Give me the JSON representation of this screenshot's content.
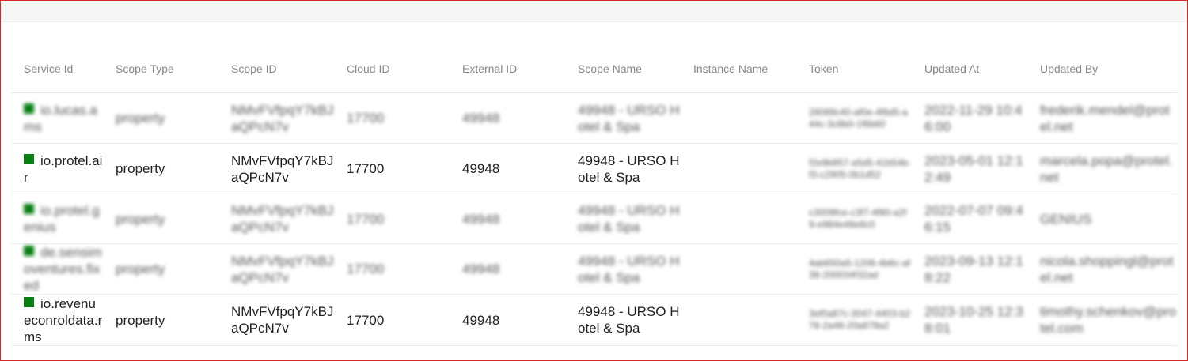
{
  "colors": {
    "frame": "#d42a2a",
    "status_square": "#0a7f14",
    "header_text": "#888888"
  },
  "table": {
    "headers": [
      "Service Id",
      "Scope Type",
      "Scope ID",
      "Cloud ID",
      "External ID",
      "Scope Name",
      "Instance Name",
      "Token",
      "Updated At",
      "Updated By"
    ],
    "rows": [
      {
        "service_id": "io.lucas.ams",
        "scope_type": "property",
        "scope_id": "NMvFVfpqY7kBJaQPcN7v",
        "cloud_id": "17700",
        "external_id": "49948",
        "scope_name": "49948 - URSO Hotel & Spa",
        "instance_name": "",
        "token": "28089c40-af0e-4f6d5-a44c-3c8b0-1f6b60",
        "updated_at": "2022-11-29 10:46:00",
        "updated_by": "frederik.mendel@protel.net",
        "blurred": true
      },
      {
        "service_id": "io.protel.air",
        "scope_type": "property",
        "scope_id": "NMvFVfpqY7kBJaQPcN7v",
        "cloud_id": "17700",
        "external_id": "49948",
        "scope_name": "49948 - URSO Hotel & Spa",
        "instance_name": "",
        "token": "f2e9b857-a5d5-41b54b-f3-c2905-0b1d52",
        "updated_at": "2023-05-01 12:12:49",
        "updated_by": "marcela.popa@protel.net",
        "blurred": false
      },
      {
        "service_id": "io.protel.genius",
        "scope_type": "property",
        "scope_id": "NMvFVfpqY7kBJaQPcN7v",
        "cloud_id": "17700",
        "external_id": "49948",
        "scope_name": "49948 - URSO Hotel & Spa",
        "instance_name": "",
        "token": "c3009fce-c3f7-4f80-a2f9-e984e48e8c0",
        "updated_at": "2022-07-07 09:46:15",
        "updated_by": "GENIUS",
        "blurred": true
      },
      {
        "service_id": "de.sensimoventures.fixed",
        "scope_type": "property",
        "scope_id": "NMvFVfpqY7kBJaQPcN7v",
        "cloud_id": "17700",
        "external_id": "49948",
        "scope_name": "49948 - URSO Hotel & Spa",
        "instance_name": "",
        "token": "4ab650a5-1206-4b6c-af38-200034f32ad",
        "updated_at": "2023-09-13 12:18:22",
        "updated_by": "nicola.shoppingl@protel.net",
        "blurred": true
      },
      {
        "service_id": "io.revenueconroldata.rms",
        "scope_type": "property",
        "scope_id": "NMvFVfpqY7kBJaQPcN7v",
        "cloud_id": "17700",
        "external_id": "49948",
        "scope_name": "49948 - URSO Hotel & Spa",
        "instance_name": "",
        "token": "3ef0a87c-3047-4403-b278-2a48-20a878a2",
        "updated_at": "2023-10-25 12:38:01",
        "updated_by": "timothy.schenkov@protel.com",
        "blurred": false
      }
    ]
  }
}
